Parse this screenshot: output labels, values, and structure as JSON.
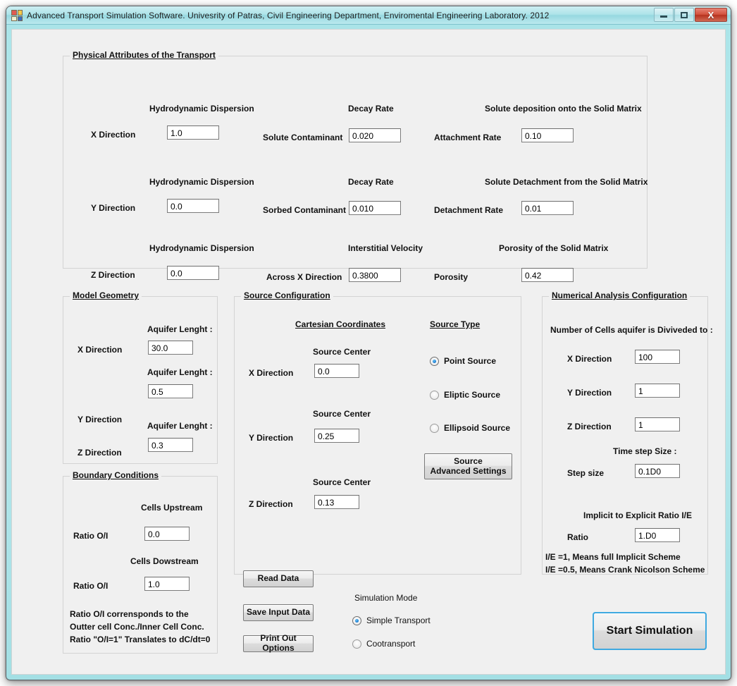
{
  "window": {
    "title": "Advanced  Transport Simulation Software.    Univesrity of Patras, Civil Engineering Department,  Enviromental Engineering  Laboratory.  2012",
    "minimize_glyph": "minimize-icon",
    "maximize_glyph": "maximize-icon",
    "close_glyph": "X",
    "accent_color": "#3fa9e0",
    "titlebar_color": "#aee3e9",
    "close_color": "#c2452f"
  },
  "physical_attributes": {
    "title": "Physical Attributes of the Transport",
    "rows": [
      {
        "col1_header": "Hydrodynamic Dispersion",
        "col1_label": "X  Direction",
        "col1_value": "1.0",
        "col2_header": "Decay Rate",
        "col2_label": "Solute  Contaminant",
        "col2_value": "0.020",
        "col3_header": "Solute  deposition onto the Solid Matrix",
        "col3_label": "Attachment  Rate",
        "col3_value": "0.10"
      },
      {
        "col1_header": "Hydrodynamic Dispersion",
        "col1_label": "Y  Direction",
        "col1_value": "0.0",
        "col2_header": "Decay Rate",
        "col2_label": "Sorbed Contaminant",
        "col2_value": "0.010",
        "col3_header": "Solute Detachment from the Solid Matrix",
        "col3_label": "Detachment Rate",
        "col3_value": "0.01"
      },
      {
        "col1_header": "Hydrodynamic Dispersion",
        "col1_label": "Z  Direction",
        "col1_value": "0.0",
        "col2_header": "Interstitial Velocity",
        "col2_label": "Across X Direction",
        "col2_value": "0.3800",
        "col3_header": "Porosity  of the Solid Matrix",
        "col3_label": "Porosity",
        "col3_value": "0.42"
      }
    ]
  },
  "model_geometry": {
    "title": "Model Geometry",
    "rows": [
      {
        "header": "Aquifer Lenght :",
        "label": "X  Direction",
        "value": "30.0"
      },
      {
        "header": "Aquifer Lenght :",
        "label": "Y  Direction",
        "value": "0.5"
      },
      {
        "header": "Aquifer Lenght :",
        "label": "Z  Direction",
        "value": "0.3"
      }
    ]
  },
  "boundary_conditions": {
    "title": "Boundary Conditions",
    "upstream_header": "Cells  Upstream",
    "upstream_label": "Ratio O/I",
    "upstream_value": "0.0",
    "downstream_header": "Cells  Dowstream",
    "downstream_label": "Ratio O/I",
    "downstream_value": "1.0",
    "note_line1": "Ratio O/I corrensponds to the",
    "note_line2": "Outter cell Conc./Inner Cell Conc.",
    "note_line3": "Ratio \"O/I=1\"  Translates to dC/dt=0"
  },
  "source_configuration": {
    "title": "Source Configuration",
    "cartesian_header": "Cartesian Coordinates",
    "source_type_header": "Source Type",
    "coords": [
      {
        "header": "Source Center",
        "label": "X  Direction",
        "value": "0.0"
      },
      {
        "header": "Source Center",
        "label": "Y  Direction",
        "value": "0.25"
      },
      {
        "header": "Source Center",
        "label": "Z  Direction",
        "value": "0.13"
      }
    ],
    "source_types": [
      {
        "label": "Point Source",
        "selected": true
      },
      {
        "label": "Eliptic Source",
        "selected": false
      },
      {
        "label": "Ellipsoid Source",
        "selected": false
      }
    ],
    "advanced_button_line1": "Source",
    "advanced_button_line2": "Advanced Settings"
  },
  "numerical_analysis": {
    "title": "Numerical Analysis Configuration",
    "cells_header": "Number of Cells aquifer is Diviveded to :",
    "cells": [
      {
        "label": "X  Direction",
        "value": "100"
      },
      {
        "label": "Y  Direction",
        "value": "1"
      },
      {
        "label": "Z  Direction",
        "value": "1"
      }
    ],
    "time_step_header": "Time step Size :",
    "step_label": "Step size",
    "step_value": "0.1D0",
    "ratio_header": "Implicit to Explicit Ratio I/E",
    "ratio_label": "Ratio",
    "ratio_value": "1.D0",
    "note_line1": "I/E =1,    Means full Implicit Scheme",
    "note_line2": "I/E =0.5,  Means Crank Nicolson Scheme"
  },
  "actions": {
    "read_data": "Read  Data",
    "save_input_data": "Save  Input Data",
    "print_out_options": "Print Out Options",
    "start_simulation": "Start Simulation"
  },
  "simulation_mode": {
    "header": "Simulation Mode",
    "options": [
      {
        "label": "Simple Transport",
        "selected": true
      },
      {
        "label": "Cootransport",
        "selected": false
      }
    ]
  }
}
